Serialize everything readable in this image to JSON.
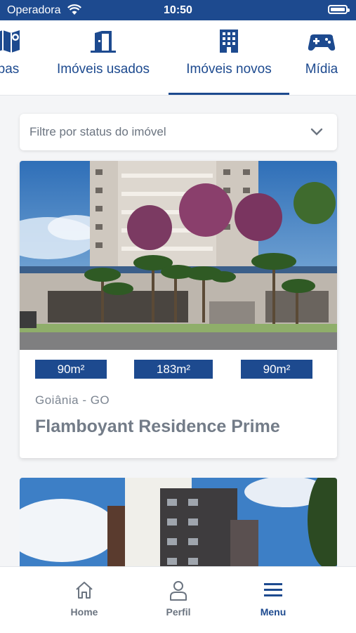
{
  "status_bar": {
    "carrier": "Operadora",
    "time": "10:50"
  },
  "tabs": [
    {
      "label": "pas",
      "icon": "map-icon"
    },
    {
      "label": "Imóveis usados",
      "icon": "door-icon"
    },
    {
      "label": "Imóveis novos",
      "icon": "building-icon",
      "active": true
    },
    {
      "label": "Mídia",
      "icon": "gamepad-icon"
    }
  ],
  "filter": {
    "placeholder": "Filtre por status do imóvel"
  },
  "listings": [
    {
      "areas": [
        "90m²",
        "183m²",
        "90m²"
      ],
      "city": "Goiânia - GO",
      "name": "Flamboyant Residence Prime"
    }
  ],
  "bottom_nav": [
    {
      "label": "Home",
      "icon": "home-icon"
    },
    {
      "label": "Perfil",
      "icon": "user-icon"
    },
    {
      "label": "Menu",
      "icon": "menu-icon",
      "active": true
    }
  ],
  "colors": {
    "brand": "#1d4a8f",
    "muted_text": "#737c88"
  }
}
